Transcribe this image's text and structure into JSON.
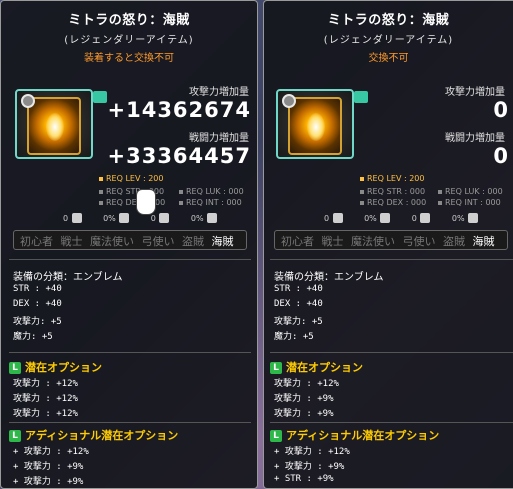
{
  "left": {
    "title": "ミトラの怒り：海賊",
    "grade": "(レジェンダリーアイテム)",
    "trade": "装着すると交換不可",
    "attack_label": "攻撃力増加量",
    "attack_value": "+14362674",
    "battle_label": "戦闘力増加量",
    "battle_value": "+33364457",
    "req": {
      "lev": "REQ LEV : 200",
      "str": "REQ STR : 000",
      "luk": "REQ LUK : 000",
      "dex": "REQ DEX : 000",
      "int": "REQ INT : 000"
    },
    "slots": [
      "0",
      "0%",
      "0",
      "0%"
    ],
    "jobs": [
      "初心者",
      "戦士",
      "魔法使い",
      "弓使い",
      "盗賊",
      "海賊"
    ],
    "active_job": "海賊",
    "stats": [
      "装備の分類：エンブレム",
      "STR : +40",
      "DEX : +40",
      "攻撃力: +5",
      "魔力: +5"
    ],
    "potential_title": "潜在オプション",
    "potential_mark": "L",
    "potential": [
      "攻撃力 : +12%",
      "攻撃力 : +12%",
      "攻撃力 : +12%"
    ],
    "additional_title": "アディショナル潜在オプション",
    "additional": [
      "+ 攻撃力 : +12%",
      "+ 攻撃力 : +9%",
      "+ 攻撃力 : +9%"
    ]
  },
  "right": {
    "title": "ミトラの怒り：海賊",
    "grade": "(レジェンダリーアイテム)",
    "trade": "交換不可",
    "attack_label": "攻撃力増加量",
    "attack_value": "0",
    "battle_label": "戦闘力増加量",
    "battle_value": "0",
    "req": {
      "lev": "REQ LEV : 200",
      "str": "REQ STR : 000",
      "luk": "REQ LUK : 000",
      "dex": "REQ DEX : 000",
      "int": "REQ INT : 000"
    },
    "slots": [
      "0",
      "0%",
      "0",
      "0%"
    ],
    "jobs": [
      "初心者",
      "戦士",
      "魔法使い",
      "弓使い",
      "盗賊",
      "海賊"
    ],
    "active_job": "海賊",
    "stats": [
      "装備の分類：エンブレム",
      "STR : +40",
      "DEX : +40",
      "攻撃力: +5",
      "魔力: +5"
    ],
    "potential_title": "潜在オプション",
    "potential_mark": "L",
    "potential": [
      "攻撃力 : +12%",
      "攻撃力 : +9%",
      "攻撃力 : +9%"
    ],
    "additional_title": "アディショナル潜在オプション",
    "additional": [
      "+ 攻撃力 : +12%",
      "+ 攻撃力 : +9%",
      "+ STR : +9%"
    ]
  },
  "colors": {
    "trade_orange": "#ff9b2b",
    "req_lev_gold": "#ffbf40",
    "potential_yellow": "#ffcc00",
    "legendary_green": "#2fb84a",
    "icon_frame_teal": "#6fd8c8"
  },
  "icons": {
    "item": "emblem-icon",
    "lock": "swirl-icon",
    "cursor": "hand-cursor-icon",
    "potential": "legendary-potential-icon"
  }
}
